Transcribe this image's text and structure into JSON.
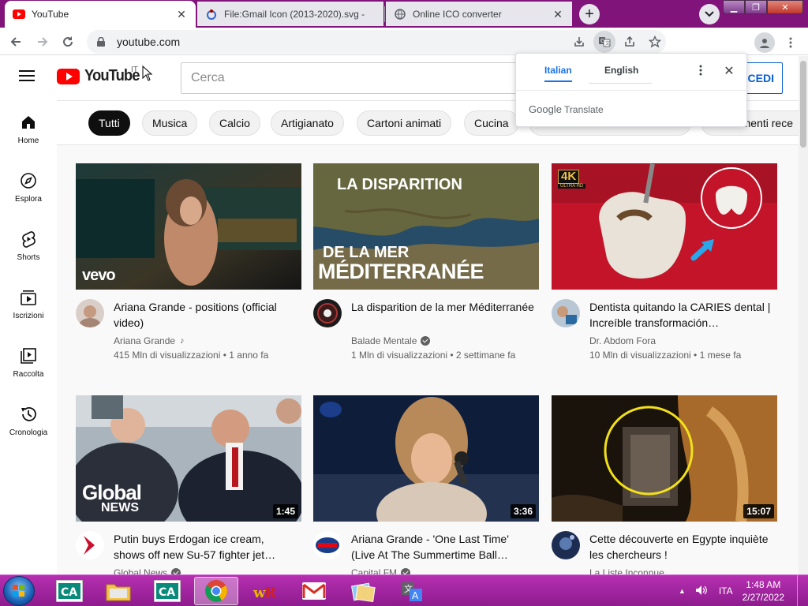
{
  "browser": {
    "tabs": [
      {
        "title": "YouTube",
        "active": true
      },
      {
        "title": "File:Gmail Icon (2013-2020).svg -",
        "active": false
      },
      {
        "title": "Online ICO converter",
        "active": false
      }
    ],
    "url": "youtube.com"
  },
  "youtube": {
    "logo_text": "YouTube",
    "region": "IT",
    "search_placeholder": "Cerca",
    "signin_label": "ACCEDI",
    "sidebar": [
      {
        "label": "Home",
        "icon": "home-icon"
      },
      {
        "label": "Esplora",
        "icon": "compass-icon"
      },
      {
        "label": "Shorts",
        "icon": "shorts-icon"
      },
      {
        "label": "Iscrizioni",
        "icon": "subscriptions-icon"
      },
      {
        "label": "Raccolta",
        "icon": "library-icon"
      },
      {
        "label": "Cronologia",
        "icon": "history-icon"
      }
    ],
    "chips": [
      "Tutti",
      "Musica",
      "Calcio",
      "Artigianato",
      "Cartoni animati",
      "Cucina",
      "menti rece"
    ],
    "videos": [
      {
        "title": "Ariana Grande - positions (official video)",
        "channel": "Ariana Grande",
        "badge": "music",
        "stats": "415 Mln di visualizzazioni • 1 anno fa",
        "duration": "",
        "overlay": "vevo"
      },
      {
        "title": "La disparition de la mer Méditerranée",
        "channel": "Balade Mentale",
        "badge": "verified",
        "stats": "1 Mln di visualizzazioni • 2 settimane fa",
        "duration": "",
        "overlay_top": "LA DISPARITION",
        "overlay_mid": "DE LA MER",
        "overlay_bot": "MÉDITERRANÉE"
      },
      {
        "title": "Dentista quitando la CARIES dental | Increíble transformación…",
        "channel": "Dr. Abdom Fora",
        "badge": "",
        "stats": "10 Mln di visualizzazioni • 1 mese fa",
        "duration": "",
        "overlay": "4K",
        "overlay_sub": "ULTRA HD"
      },
      {
        "title": "Putin buys Erdogan ice cream, shows off new Su-57 fighter jet…",
        "channel": "Global News",
        "badge": "verified",
        "stats": "",
        "duration": "1:45",
        "overlay": "Global",
        "overlay_sub": "NEWS"
      },
      {
        "title": "Ariana Grande - 'One Last Time' (Live At The Summertime Ball…",
        "channel": "Capital FM",
        "badge": "verified",
        "stats": "",
        "duration": "3:36"
      },
      {
        "title": "Cette découverte en Egypte inquiète les chercheurs !",
        "channel": "La Liste Inconnue",
        "badge": "",
        "stats": "",
        "duration": "15:07"
      }
    ]
  },
  "translate_popup": {
    "lang_source": "Italian",
    "lang_target": "English",
    "brand": "Google",
    "brand_suffix": "Translate"
  },
  "taskbar": {
    "language": "ITA",
    "time": "1:48 AM",
    "date": "2/27/2022"
  },
  "colors": {
    "titlebar": "#80147a",
    "taskbar": "#9b2199",
    "yt_red": "#ff0000",
    "accent_blue": "#1a73e8"
  }
}
